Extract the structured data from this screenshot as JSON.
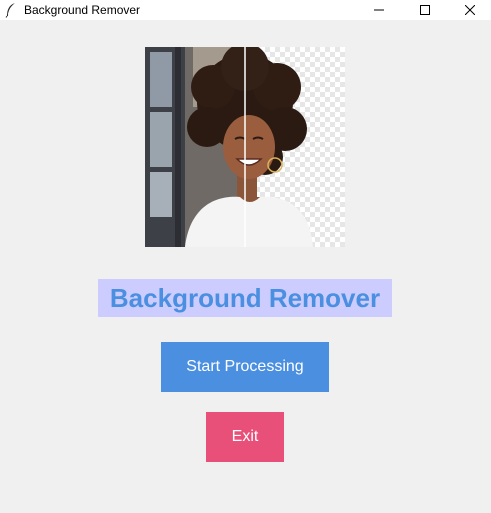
{
  "window": {
    "title": "Background Remover",
    "icon": "feather-icon",
    "controls": {
      "minimize_icon": "minimize-icon",
      "maximize_icon": "maximize-icon",
      "close_icon": "close-icon"
    }
  },
  "preview": {
    "description_icon": "before-after-image",
    "split": "left-original-right-removed"
  },
  "main": {
    "heading": "Background Remover",
    "start_button": "Start Processing",
    "exit_button": "Exit"
  },
  "colors": {
    "heading_text": "#4a8fe0",
    "heading_bg": "#ccccff",
    "start_button_bg": "#4a8fe0",
    "exit_button_bg": "#e8507a",
    "window_bg": "#f0f0f0"
  }
}
